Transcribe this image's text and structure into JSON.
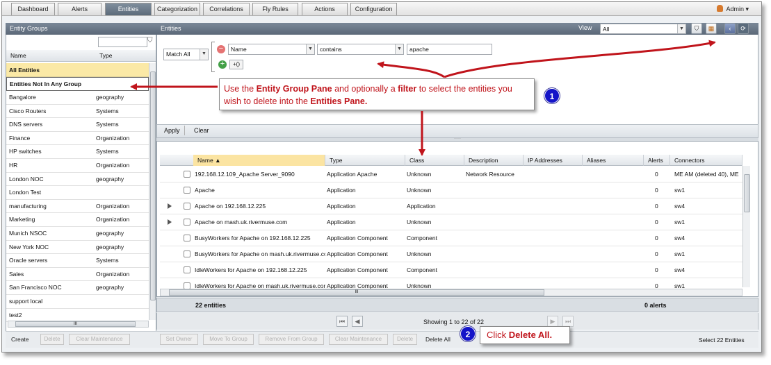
{
  "nav": {
    "tabs": [
      "Dashboard",
      "Alerts",
      "Entities",
      "Categorization",
      "Correlations",
      "Fly Rules",
      "Actions",
      "Configuration"
    ],
    "active": "Entities",
    "user": "Admin"
  },
  "left": {
    "title": "Entity Groups",
    "col_name": "Name",
    "col_type": "Type",
    "all_entities": "All Entities",
    "not_in_group": "Entities Not In Any Group",
    "groups": [
      {
        "name": "Bangalore",
        "type": "geography"
      },
      {
        "name": "Cisco Routers",
        "type": "Systems"
      },
      {
        "name": "DNS servers",
        "type": "Systems"
      },
      {
        "name": "Finance",
        "type": "Organization"
      },
      {
        "name": "HP switches",
        "type": "Systems"
      },
      {
        "name": "HR",
        "type": "Organization"
      },
      {
        "name": "London NOC",
        "type": "geography"
      },
      {
        "name": "London Test",
        "type": ""
      },
      {
        "name": "manufacturing",
        "type": "Organization"
      },
      {
        "name": "Marketing",
        "type": "Organization"
      },
      {
        "name": "Munich NSOC",
        "type": "geography"
      },
      {
        "name": "New York NOC",
        "type": "geography"
      },
      {
        "name": "Oracle servers",
        "type": "Systems"
      },
      {
        "name": "Sales",
        "type": "Organization"
      },
      {
        "name": "San Francisco NOC",
        "type": "geography"
      },
      {
        "name": "support local",
        "type": ""
      },
      {
        "name": "test2",
        "type": ""
      }
    ],
    "buttons": {
      "create": "Create",
      "delete": "Delete",
      "clear_maintenance": "Clear Maintenance"
    }
  },
  "entities": {
    "title": "Entities",
    "view_label": "View",
    "view_value": "All",
    "match": "Match All",
    "filter_field": "Name",
    "filter_op": "contains",
    "filter_value": "apache",
    "group_btn": "+()",
    "apply": "Apply",
    "clear": "Clear",
    "columns": [
      "Name",
      "Type",
      "Class",
      "Description",
      "IP Addresses",
      "Aliases",
      "Alerts",
      "Connectors"
    ],
    "rows": [
      {
        "expand": false,
        "name": "192.168.12.109_Apache Server_9090",
        "type": "Application Apache",
        "class": "Unknown",
        "description": "Network Resource",
        "alerts": "0",
        "connectors": "ME AM (deleted 40), ME"
      },
      {
        "expand": false,
        "name": "Apache",
        "type": "Application",
        "class": "Unknown",
        "description": "",
        "alerts": "0",
        "connectors": "sw1"
      },
      {
        "expand": true,
        "name": "Apache on 192.168.12.225",
        "type": "Application",
        "class": "Application",
        "description": "",
        "alerts": "0",
        "connectors": "sw4"
      },
      {
        "expand": true,
        "name": "Apache on mash.uk.rivermuse.com",
        "type": "Application",
        "class": "Unknown",
        "description": "",
        "alerts": "0",
        "connectors": "sw1"
      },
      {
        "expand": false,
        "name": "BusyWorkers for Apache on 192.168.12.225",
        "type": "Application Component",
        "class": "Component",
        "description": "",
        "alerts": "0",
        "connectors": "sw4"
      },
      {
        "expand": false,
        "name": "BusyWorkers for Apache on mash.uk.rivermuse.com",
        "type": "Application Component",
        "class": "Unknown",
        "description": "",
        "alerts": "0",
        "connectors": "sw1"
      },
      {
        "expand": false,
        "name": "IdleWorkers for Apache on 192.168.12.225",
        "type": "Application Component",
        "class": "Component",
        "description": "",
        "alerts": "0",
        "connectors": "sw4"
      },
      {
        "expand": false,
        "name": "IdleWorkers for Apache on mash.uk.rivermuse.com",
        "type": "Application Component",
        "class": "Unknown",
        "description": "",
        "alerts": "0",
        "connectors": "sw1"
      }
    ],
    "scroll_mark": "III",
    "count": "22 entities",
    "alerts_count": "0 alerts",
    "paging": "Showing 1 to 22 of 22",
    "buttons": {
      "set_owner": "Set Owner",
      "move_to_group": "Move To Group",
      "remove_from_group": "Remove From Group",
      "clear_maintenance": "Clear Maintenance",
      "delete": "Delete",
      "delete_all": "Delete All"
    },
    "select_status": "Select 22 Entities"
  },
  "callouts": {
    "one": {
      "number": "1",
      "pre": "Use the ",
      "b1": "Entity Group Pane",
      "mid1": " and optionally a ",
      "b2": "filter",
      "mid2": " to select the entities you wish to delete into the ",
      "b3": "Entities Pane.",
      "post": ""
    },
    "two": {
      "number": "2",
      "pre": "Click ",
      "b1": "Delete All.",
      "post": ""
    }
  },
  "colors": {
    "callout_text": "#c0141b",
    "arrow": "#c0141b",
    "badge": "#1414c8",
    "titlebar": "#66737f",
    "selected_group": "#fbe9a6"
  }
}
